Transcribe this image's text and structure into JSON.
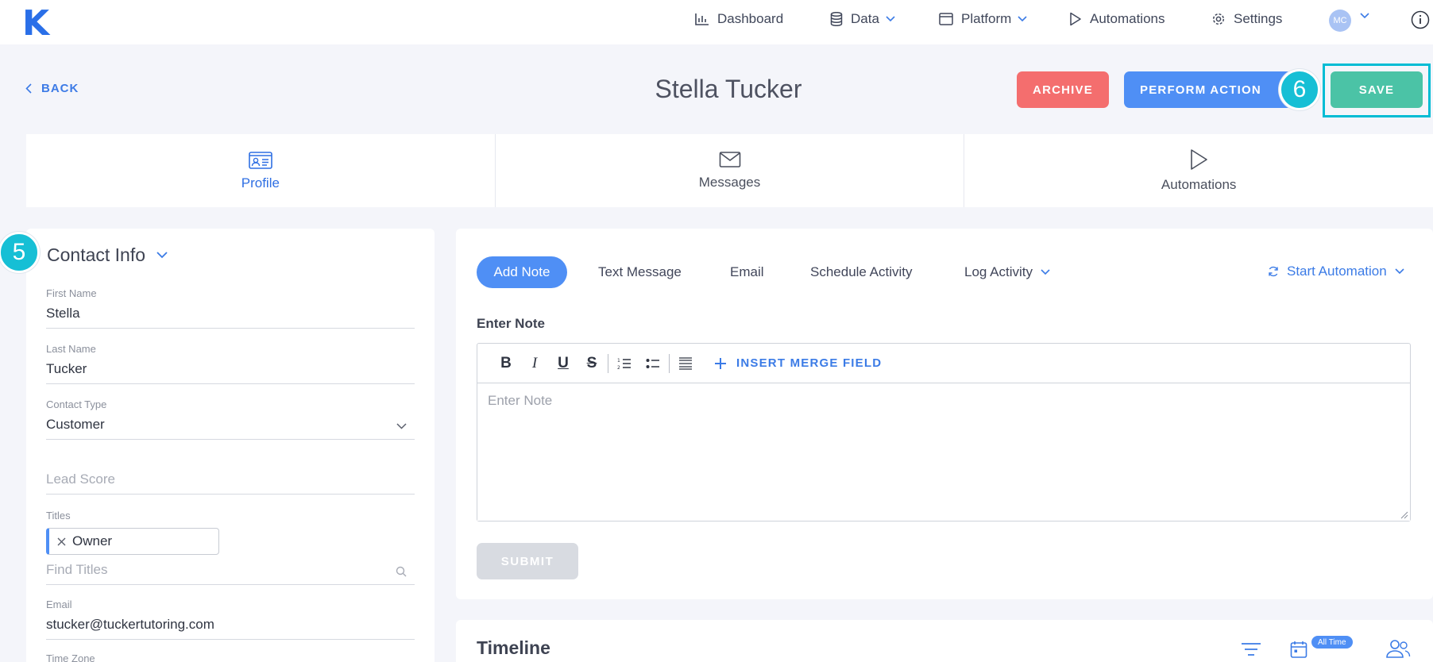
{
  "logo": "K",
  "nav": {
    "items": [
      {
        "label": "Dashboard"
      },
      {
        "label": "Data"
      },
      {
        "label": "Platform"
      },
      {
        "label": "Automations"
      },
      {
        "label": "Settings"
      }
    ],
    "user_initials": "MC"
  },
  "header": {
    "back_label": "BACK",
    "title": "Stella Tucker",
    "archive_label": "ARCHIVE",
    "perform_label": "PERFORM ACTION",
    "save_label": "SAVE",
    "step_save": "6"
  },
  "tabs": [
    {
      "label": "Profile",
      "icon": "id-card-icon",
      "active": true
    },
    {
      "label": "Messages",
      "icon": "envelope-icon"
    },
    {
      "label": "Automations",
      "icon": "play-icon"
    }
  ],
  "contact": {
    "step": "5",
    "title": "Contact Info",
    "fields": {
      "first_name_label": "First Name",
      "first_name": "Stella",
      "last_name_label": "Last Name",
      "last_name": "Tucker",
      "contact_type_label": "Contact Type",
      "contact_type": "Customer",
      "lead_score_placeholder": "Lead Score",
      "titles_label": "Titles",
      "title_chip": "Owner",
      "find_titles_placeholder": "Find Titles",
      "email_label": "Email",
      "email": "stucker@tuckertutoring.com",
      "time_zone_label": "Time Zone"
    }
  },
  "activity": {
    "tabs": [
      {
        "label": "Add Note",
        "active": true
      },
      {
        "label": "Text Message"
      },
      {
        "label": "Email"
      },
      {
        "label": "Schedule Activity"
      },
      {
        "label": "Log Activity"
      }
    ],
    "start_automation": "Start Automation",
    "enter_note_label": "Enter Note",
    "note_placeholder": "Enter Note",
    "toolbar": {
      "bold": "B",
      "italic": "I",
      "underline": "U",
      "strike": "S"
    },
    "merge_field": "INSERT MERGE FIELD",
    "submit_label": "SUBMIT"
  },
  "timeline": {
    "title": "Timeline",
    "badge": "All Time"
  },
  "colors": {
    "primary": "#4f8ff5",
    "archive": "#f46e6e",
    "save": "#4bc3a6",
    "step_marker": "#16bfd5"
  }
}
